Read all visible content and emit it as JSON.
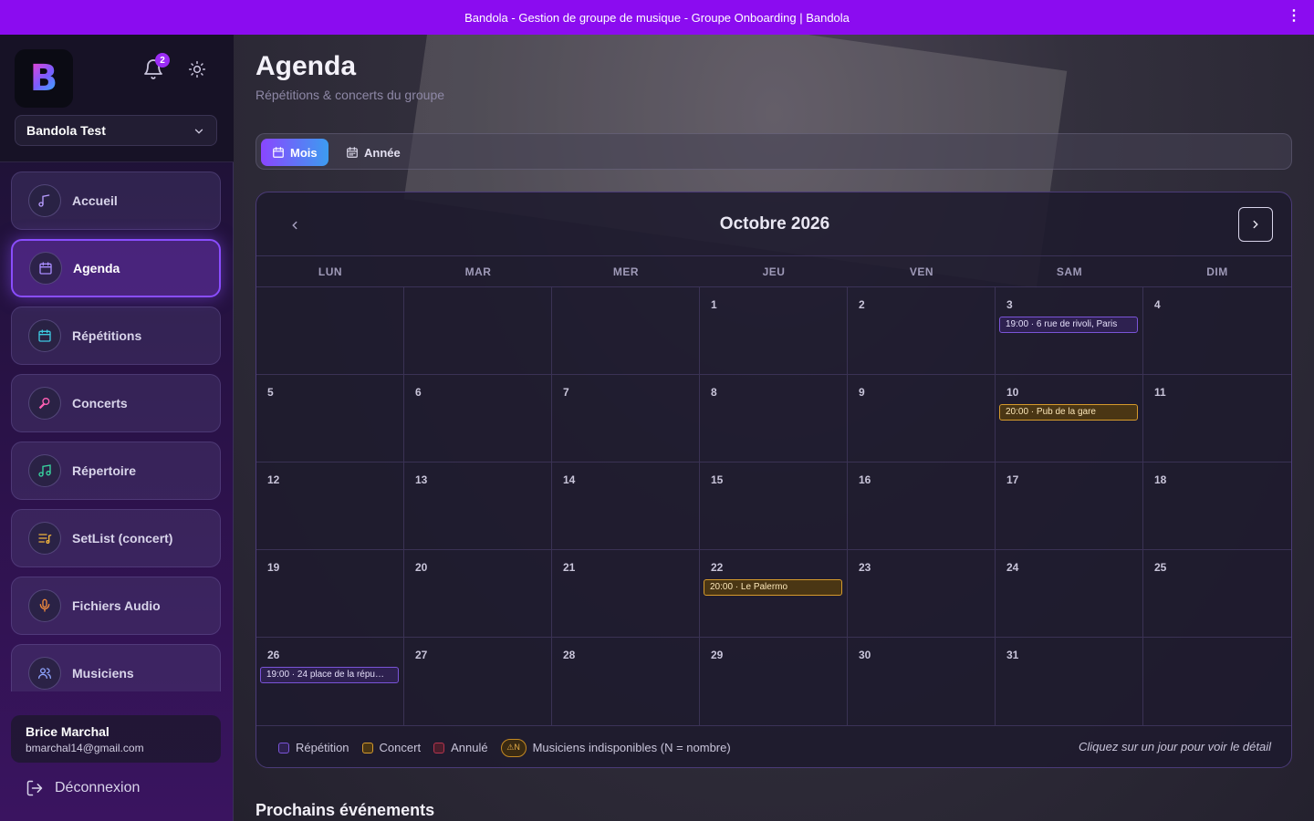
{
  "window": {
    "title": "Bandola - Gestion de groupe de musique - Groupe Onboarding | Bandola"
  },
  "sidebar": {
    "notifications_count": "2",
    "group_name": "Bandola Test",
    "items": [
      {
        "label": "Accueil",
        "icon": "music-note-icon",
        "color": "#b79cff"
      },
      {
        "label": "Agenda",
        "icon": "calendar-icon",
        "color": "#a88cff",
        "active": true
      },
      {
        "label": "Répétitions",
        "icon": "calendar-icon",
        "color": "#3cc8e0"
      },
      {
        "label": "Concerts",
        "icon": "microphone-icon",
        "color": "#ff5fb4"
      },
      {
        "label": "Répertoire",
        "icon": "music-notes-icon",
        "color": "#38d6a0"
      },
      {
        "label": "SetList (concert)",
        "icon": "playlist-icon",
        "color": "#f0b43c"
      },
      {
        "label": "Fichiers Audio",
        "icon": "microphone-icon",
        "color": "#f08a3c"
      },
      {
        "label": "Musiciens",
        "icon": "users-icon",
        "color": "#8fa4ff"
      }
    ],
    "user": {
      "name": "Brice Marchal",
      "email": "bmarchal14@gmail.com"
    },
    "logout_label": "Déconnexion"
  },
  "main": {
    "title": "Agenda",
    "subtitle": "Répétitions & concerts du groupe",
    "views": [
      "Mois",
      "Année"
    ],
    "active_view": "Mois",
    "calendar": {
      "month_label": "Octobre 2026",
      "weekdays": [
        "LUN",
        "MAR",
        "MER",
        "JEU",
        "VEN",
        "SAM",
        "DIM"
      ],
      "weeks": [
        [
          {
            "day": ""
          },
          {
            "day": ""
          },
          {
            "day": ""
          },
          {
            "day": "1"
          },
          {
            "day": "2"
          },
          {
            "day": "3",
            "event": {
              "text": "19:00 · 6 rue de rivoli, Paris",
              "type": "rep"
            }
          },
          {
            "day": "4"
          }
        ],
        [
          {
            "day": "5"
          },
          {
            "day": "6"
          },
          {
            "day": "7"
          },
          {
            "day": "8"
          },
          {
            "day": "9"
          },
          {
            "day": "10",
            "event": {
              "text": "20:00 · Pub de la gare",
              "type": "con"
            }
          },
          {
            "day": "11"
          }
        ],
        [
          {
            "day": "12"
          },
          {
            "day": "13"
          },
          {
            "day": "14"
          },
          {
            "day": "15"
          },
          {
            "day": "16"
          },
          {
            "day": "17"
          },
          {
            "day": "18"
          }
        ],
        [
          {
            "day": "19"
          },
          {
            "day": "20"
          },
          {
            "day": "21"
          },
          {
            "day": "22",
            "event": {
              "text": "20:00 · Le Palermo",
              "type": "con"
            }
          },
          {
            "day": "23"
          },
          {
            "day": "24"
          },
          {
            "day": "25"
          }
        ],
        [
          {
            "day": "26",
            "event": {
              "text": "19:00 · 24 place de la répu…",
              "type": "rep"
            }
          },
          {
            "day": "27"
          },
          {
            "day": "28"
          },
          {
            "day": "29"
          },
          {
            "day": "30"
          },
          {
            "day": "31"
          },
          {
            "day": ""
          }
        ]
      ]
    },
    "legend": {
      "repetition": "Répétition",
      "concert": "Concert",
      "annule": "Annulé",
      "unavailable_badge": "⚠N",
      "unavailable": "Musiciens indisponibles (N = nombre)",
      "hint": "Cliquez sur un jour pour voir le détail"
    },
    "upcoming_title": "Prochains événements"
  },
  "colors": {
    "titlebar": "#8b0cf0",
    "accent": "#8a4dff",
    "repetition": "#7a54d8",
    "concert": "#d59a2c",
    "cancelled": "#b4344e"
  }
}
